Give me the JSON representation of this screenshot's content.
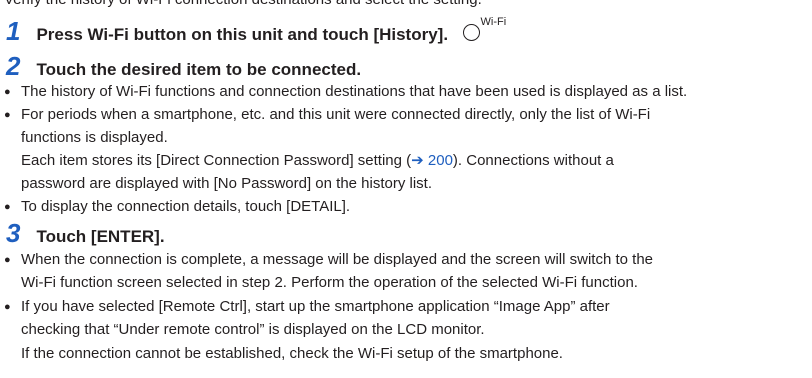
{
  "intro_fragment": "Verify the history of Wi-Fi connection destinations and select the setting.",
  "steps": [
    {
      "number": "1",
      "title": "Press Wi-Fi button on this unit and touch [History].",
      "icon": {
        "name": "wifi-button-icon",
        "label": "Wi-Fi"
      }
    },
    {
      "number": "2",
      "title": "Touch the desired item to be connected.",
      "bullets": [
        {
          "lines": [
            "The history of Wi-Fi functions and connection destinations that have been used is displayed as a list."
          ]
        },
        {
          "lines": [
            "For periods when a smartphone, etc. and this unit were connected directly, only the list of Wi-Fi",
            "functions is displayed."
          ],
          "note_before": "Each item stores its [Direct Connection Password] setting (",
          "note_ref": "➔ 200",
          "note_after": "). Connections without a",
          "note_line2": "password are displayed with [No Password] on the history list."
        },
        {
          "lines": [
            "To display the connection details, touch [DETAIL]."
          ]
        }
      ]
    },
    {
      "number": "3",
      "title": "Touch [ENTER].",
      "bullets": [
        {
          "lines": [
            "When the connection is complete, a message will be displayed and the screen will switch to the",
            "Wi-Fi function screen selected in step 2. Perform the operation of the selected Wi-Fi function."
          ]
        },
        {
          "lines": [
            "If you have selected [Remote Ctrl], start up the smartphone application “Image App” after",
            "checking that “Under remote control” is displayed on the LCD monitor."
          ],
          "note_line": "If the connection cannot be established, check the Wi-Fi setup of the smartphone."
        }
      ]
    }
  ],
  "colors": {
    "step_number": "#1f5fbf",
    "link": "#1f5fbf",
    "text": "#231f20"
  }
}
